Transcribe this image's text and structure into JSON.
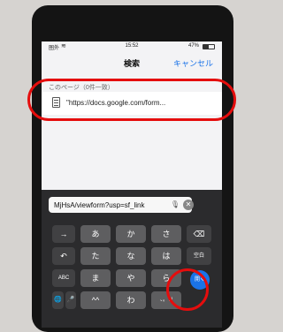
{
  "status_bar": {
    "carrier": "圏外",
    "time": "15:52",
    "battery_pct": "47%",
    "battery_level": 0.47
  },
  "nav": {
    "title": "検索",
    "cancel_label": "キャンセル"
  },
  "results": {
    "section_header": "このページ（0件一致）",
    "items": [
      {
        "text": "\"https://docs.google.com/form..."
      }
    ]
  },
  "search": {
    "value": "MjHsA/viewform?usp=sf_link"
  },
  "keyboard": {
    "row1": [
      "→",
      "あ",
      "か",
      "さ",
      "⌫"
    ],
    "row2": [
      "↶",
      "た",
      "な",
      "は",
      "空白"
    ],
    "row3": [
      "ABC",
      "ま",
      "や",
      "ら"
    ],
    "row4": [
      "🌐",
      "🎤",
      "^^",
      "わ",
      "、。?!"
    ],
    "go_label": "開く"
  },
  "colors": {
    "accent": "#1a73e8",
    "highlight_ring": "#e50d0d"
  }
}
